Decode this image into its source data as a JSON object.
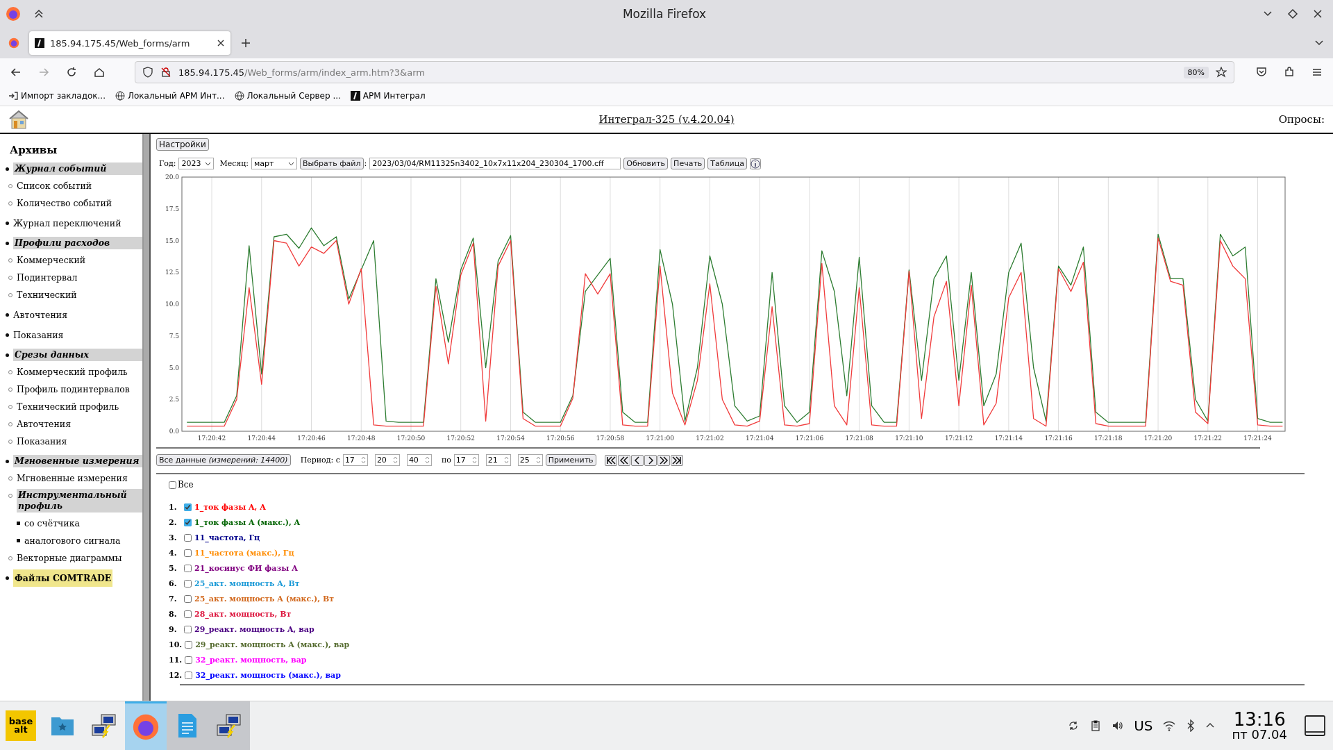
{
  "browser": {
    "window_title": "Mozilla Firefox",
    "tab": {
      "title": "185.94.175.45/Web_forms/arm",
      "selected": true
    },
    "url": {
      "host": "185.94.175.45",
      "path": "/Web_forms/arm/index_arm.htm?3&arm"
    },
    "zoom": "80%",
    "bookmarks": [
      {
        "kind": "import",
        "label": "Импорт закладок..."
      },
      {
        "kind": "globe",
        "label": "Локальный АРМ Инт..."
      },
      {
        "kind": "globe",
        "label": "Локальный Сервер ..."
      },
      {
        "kind": "app",
        "label": "АРМ Интеграл"
      }
    ]
  },
  "header": {
    "title": "Интеграл-325 (v.4.20.04)",
    "polls_label": "Опросы:"
  },
  "sidebar": {
    "title": "Архивы",
    "items": [
      {
        "label": "Журнал событий",
        "kind": "group",
        "children": [
          {
            "label": "Список событий",
            "kind": "link"
          },
          {
            "label": "Количество событий",
            "kind": "link"
          }
        ]
      },
      {
        "label": "Журнал переключений",
        "kind": "link"
      },
      {
        "label": "Профили расходов",
        "kind": "group",
        "children": [
          {
            "label": "Коммерческий",
            "kind": "link"
          },
          {
            "label": "Подинтервал",
            "kind": "link"
          },
          {
            "label": "Технический",
            "kind": "link"
          }
        ]
      },
      {
        "label": "Авточтения",
        "kind": "link"
      },
      {
        "label": "Показания",
        "kind": "link"
      },
      {
        "label": "Срезы данных",
        "kind": "group",
        "children": [
          {
            "label": "Коммерческий профиль",
            "kind": "link"
          },
          {
            "label": "Профиль подинтервалов",
            "kind": "link"
          },
          {
            "label": "Технический профиль",
            "kind": "link"
          },
          {
            "label": "Авточтения",
            "kind": "link"
          },
          {
            "label": "Показания",
            "kind": "link"
          }
        ]
      },
      {
        "label": "Мгновенные измерения",
        "kind": "group",
        "children": [
          {
            "label": "Мгновенные измерения",
            "kind": "link"
          },
          {
            "label": "Инструментальный профиль",
            "kind": "group",
            "children": [
              {
                "label": "со счётчика",
                "kind": "link"
              },
              {
                "label": "аналогового сигнала",
                "kind": "link"
              }
            ]
          },
          {
            "label": "Векторные диаграммы",
            "kind": "link"
          }
        ]
      },
      {
        "label": "Файлы COMTRADE",
        "kind": "file"
      }
    ]
  },
  "toolbar": {
    "settings_button": "Настройки",
    "year_label": "Год:",
    "year": "2023",
    "month_label": "Месяц:",
    "month": "март",
    "choose_file_button": "Выбрать файл",
    "file_separator": ":",
    "file_path": "2023/03/04/RM11325n3402_10x7x11x204_230304_1700.cff",
    "buttons": [
      "Обновить",
      "Печать",
      "Таблица"
    ]
  },
  "chart_data": {
    "type": "line",
    "ylim": [
      0,
      20
    ],
    "grid": true,
    "categories": [
      null,
      null,
      "17:20:42",
      null,
      null,
      null,
      "17:20:44",
      null,
      null,
      null,
      "17:20:46",
      null,
      null,
      null,
      "17:20:48",
      null,
      null,
      null,
      "17:20:50",
      null,
      null,
      null,
      "17:20:52",
      null,
      null,
      null,
      "17:20:54",
      null,
      null,
      null,
      "17:20:56",
      null,
      null,
      null,
      "17:20:58",
      null,
      null,
      null,
      "17:21:00",
      null,
      null,
      null,
      "17:21:02",
      null,
      null,
      null,
      "17:21:04",
      null,
      null,
      null,
      "17:21:06",
      null,
      null,
      null,
      "17:21:08",
      null,
      null,
      null,
      "17:21:10",
      null,
      null,
      null,
      "17:21:12",
      null,
      null,
      null,
      "17:21:14",
      null,
      null,
      null,
      "17:21:16",
      null,
      null,
      null,
      "17:21:18",
      null,
      null,
      null,
      "17:21:20",
      null,
      null,
      null,
      "17:21:22",
      null,
      null,
      null,
      "17:21:24",
      null,
      null
    ],
    "series": [
      {
        "color": "#2e7d32",
        "values": [
          0.7,
          0.7,
          0.7,
          0.7,
          2.8,
          14.6,
          4.5,
          15.3,
          15.5,
          14.4,
          16.0,
          14.6,
          15.3,
          10.4,
          12.7,
          15.0,
          0.8,
          0.7,
          0.7,
          0.7,
          12.0,
          7.0,
          12.7,
          15.2,
          5.0,
          13.4,
          15.4,
          1.5,
          0.7,
          0.7,
          0.7,
          2.8,
          11.0,
          12.3,
          13.6,
          1.5,
          0.7,
          0.7,
          14.3,
          10.0,
          0.8,
          5.0,
          13.8,
          10.0,
          2.0,
          0.8,
          1.2,
          12.5,
          2.0,
          0.7,
          1.5,
          14.2,
          11.0,
          2.8,
          13.7,
          2.0,
          0.7,
          0.7,
          12.7,
          4.0,
          12.0,
          13.8,
          4.0,
          12.5,
          2.0,
          4.5,
          12.5,
          14.8,
          5.0,
          0.8,
          13.0,
          11.5,
          14.5,
          1.5,
          0.7,
          0.7,
          0.7,
          0.7,
          15.5,
          12.0,
          12.0,
          2.5,
          0.8,
          15.5,
          13.8,
          14.5,
          1.0,
          0.7,
          0.7
        ]
      },
      {
        "color": "#f03c3c",
        "values": [
          0.4,
          0.4,
          0.4,
          0.4,
          2.5,
          11.3,
          3.7,
          15.0,
          14.8,
          13.0,
          14.5,
          14.0,
          15.0,
          10.0,
          12.8,
          0.5,
          0.4,
          0.4,
          0.4,
          0.4,
          11.4,
          5.3,
          12.3,
          14.8,
          0.8,
          13.0,
          15.0,
          1.0,
          0.4,
          0.4,
          0.4,
          2.6,
          12.4,
          10.8,
          12.4,
          0.5,
          0.4,
          0.4,
          13.0,
          3.0,
          0.5,
          4.0,
          11.6,
          2.5,
          0.5,
          0.4,
          0.8,
          9.8,
          0.5,
          0.4,
          0.6,
          13.2,
          2.0,
          0.5,
          11.3,
          0.5,
          0.4,
          0.4,
          12.6,
          1.0,
          9.0,
          11.8,
          2.0,
          11.5,
          0.5,
          2.2,
          10.5,
          12.5,
          1.0,
          0.4,
          12.8,
          11.0,
          13.3,
          0.6,
          0.4,
          0.4,
          0.4,
          0.4,
          15.2,
          11.8,
          11.5,
          1.5,
          0.6,
          15.0,
          13.0,
          12.0,
          0.5,
          0.4,
          0.4
        ]
      }
    ],
    "yticks": [
      {
        "value": 0,
        "label": "0.0"
      },
      {
        "value": 2.5,
        "label": "2.5"
      },
      {
        "value": 5,
        "label": "5.0"
      },
      {
        "value": 7.5,
        "label": "7.5"
      },
      {
        "value": 10,
        "label": "10.0"
      },
      {
        "value": 12.5,
        "label": "12.5"
      },
      {
        "value": 15,
        "label": "15.0"
      },
      {
        "value": 17.5,
        "label": "17.5"
      },
      {
        "value": 20,
        "label": "20.0"
      }
    ]
  },
  "period": {
    "all_data_button": "Все данные *(измерений: 14400)*",
    "label": "Период: с",
    "from": [
      "17",
      "20",
      "40"
    ],
    "to_label": "по",
    "to": [
      "17",
      "21",
      "25"
    ],
    "apply_button": "Применить"
  },
  "channels": {
    "all": {
      "label": "Все",
      "checked": false
    },
    "items": [
      {
        "number": "1.",
        "label": "1_ток фазы A, A",
        "checked": true,
        "color": "#ff0000"
      },
      {
        "number": "2.",
        "label": "1_ток фазы A (макс.), A",
        "checked": true,
        "color": "#006400"
      },
      {
        "number": "3.",
        "label": "11_частота, Гц",
        "checked": false,
        "color": "#00008b"
      },
      {
        "number": "4.",
        "label": "11_частота (макс.), Гц",
        "checked": false,
        "color": "#ff8c00"
      },
      {
        "number": "5.",
        "label": "21_косинус ФИ фазы A",
        "checked": false,
        "color": "#800080"
      },
      {
        "number": "6.",
        "label": "25_акт. мощность A, Вт",
        "checked": false,
        "color": "#1e9bd7"
      },
      {
        "number": "7.",
        "label": "25_акт. мощность A (макс.), Вт",
        "checked": false,
        "color": "#d2691e"
      },
      {
        "number": "8.",
        "label": "28_акт. мощность, Вт",
        "checked": false,
        "color": "#dc143c"
      },
      {
        "number": "9.",
        "label": "29_реакт. мощность A, вар",
        "checked": false,
        "color": "#4b0082"
      },
      {
        "number": "10.",
        "label": "29_реакт. мощность A (макс.), вар",
        "checked": false,
        "color": "#556b2f"
      },
      {
        "number": "11.",
        "label": "32_реакт. мощность, вар",
        "checked": false,
        "color": "#ff00ff"
      },
      {
        "number": "12.",
        "label": "32_реакт. мощность (макс.), вар",
        "checked": false,
        "color": "#0000ff"
      }
    ]
  },
  "taskbar": {
    "logo_words": [
      "base",
      "alt"
    ],
    "apps": [
      {
        "kind": "files",
        "running": false
      },
      {
        "kind": "network",
        "running": false
      },
      {
        "kind": "firefox",
        "running": true,
        "selected": true
      },
      {
        "kind": "document",
        "running": true,
        "selected": false
      },
      {
        "kind": "network",
        "running": true,
        "selected": false
      }
    ],
    "keyboard_layout": "US",
    "time": "13:16",
    "date": "пт 07.04"
  }
}
